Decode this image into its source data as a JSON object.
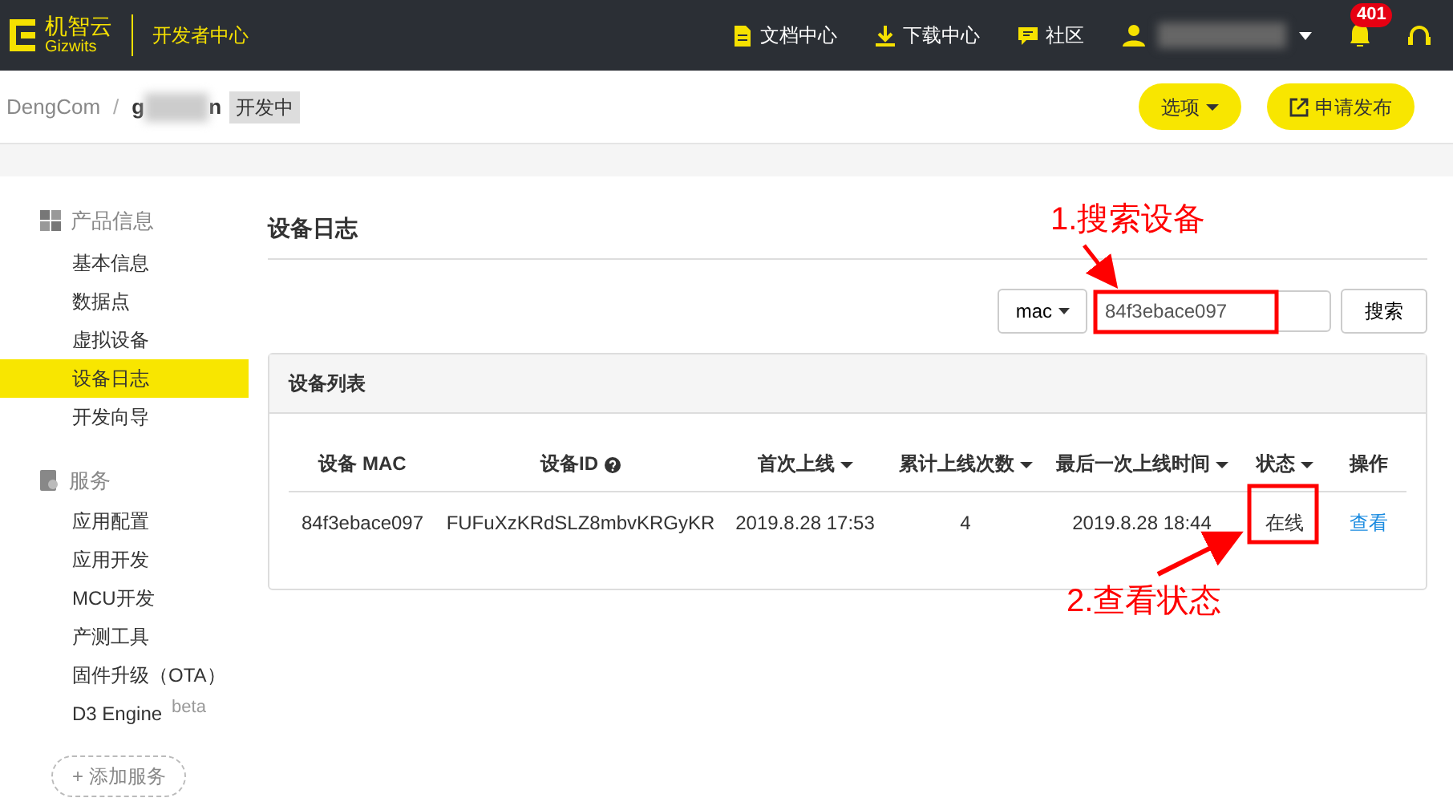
{
  "topbar": {
    "logo_text": "机智云",
    "logo_subtext": "Gizwits",
    "portal": "开发者中心",
    "links": [
      {
        "kind": "doc",
        "label": "文档中心"
      },
      {
        "kind": "download",
        "label": "下载中心"
      },
      {
        "kind": "community",
        "label": "社区"
      }
    ],
    "notifications": "401"
  },
  "breadcrumb": {
    "company": "DengCom",
    "separator": "/",
    "product_start": "g",
    "product_end": "n",
    "status": "开发中"
  },
  "actions": [
    {
      "label": "选项",
      "kind": "dropdown"
    },
    {
      "label": "申请发布",
      "kind": "external"
    }
  ],
  "sidebar": [
    {
      "title": "产品信息",
      "kind": "grid",
      "items": [
        {
          "label": "基本信息",
          "selected": false
        },
        {
          "label": "数据点",
          "selected": false
        },
        {
          "label": "虚拟设备",
          "selected": false
        },
        {
          "label": "设备日志",
          "selected": true
        },
        {
          "label": "开发向导",
          "selected": false
        }
      ]
    },
    {
      "title": "服务",
      "kind": "service",
      "items": [
        {
          "label": "应用配置",
          "selected": false
        },
        {
          "label": "应用开发",
          "selected": false
        },
        {
          "label": "MCU开发",
          "selected": false
        },
        {
          "label": "产测工具",
          "selected": false
        },
        {
          "label": "固件升级（OTA）",
          "selected": false
        },
        {
          "label": "D3 Engine",
          "tag": "beta",
          "selected": false
        }
      ]
    }
  ],
  "add_service": "+ 添加服务",
  "page_title": "设备日志",
  "search": {
    "field": "mac",
    "value": "84f3ebace097",
    "button": "搜索"
  },
  "panel_title": "设备列表",
  "table": {
    "columns": [
      {
        "label": "设备 MAC",
        "sortable": false
      },
      {
        "label": "设备ID",
        "sortable": false,
        "help": true
      },
      {
        "label": "首次上线",
        "sortable": true
      },
      {
        "label": "累计上线次数",
        "sortable": true
      },
      {
        "label": "最后一次上线时间",
        "sortable": true
      },
      {
        "label": "状态",
        "sortable": true
      },
      {
        "label": "操作",
        "sortable": false
      }
    ],
    "rows": [
      {
        "cells": [
          "84f3ebace097",
          "FUFuXzKRdSLZ8mbvKRGyKR",
          "2019.8.28 17:53",
          "4",
          "2019.8.28 18:44",
          "在线"
        ],
        "action": "查看"
      }
    ]
  },
  "annotations": [
    {
      "label": "1.搜索设备"
    },
    {
      "label": "2.查看状态"
    }
  ]
}
